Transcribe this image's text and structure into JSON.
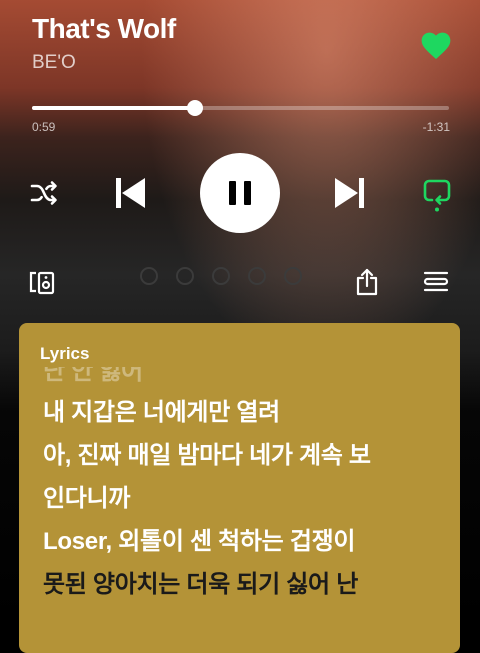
{
  "track": {
    "title": "That's Wolf",
    "artist": "BE'O",
    "liked": true
  },
  "playback": {
    "elapsed": "0:59",
    "remaining": "-1:31",
    "progress": 0.39,
    "state": "playing",
    "shuffle": false,
    "repeat": true
  },
  "colors": {
    "accent": "#1ed760",
    "lyrics_card": "#b49337",
    "background_top": "#a54b33"
  },
  "icons": {
    "like": "heart-icon",
    "shuffle": "shuffle-icon",
    "previous": "skip-previous-icon",
    "pause": "pause-icon",
    "next": "skip-next-icon",
    "repeat": "repeat-icon",
    "devices": "connect-device-icon",
    "share": "share-icon",
    "queue": "queue-icon"
  },
  "lyrics": {
    "heading": "Lyrics",
    "lines": [
      {
        "text": "난 안 잃어",
        "state": "past"
      },
      {
        "text": "내 지갑은 너에게만 열려",
        "state": "upcoming"
      },
      {
        "text": "아, 진짜 매일 밤마다 네가 계속 보",
        "state": "upcoming"
      },
      {
        "text": "인다니까",
        "state": "upcoming"
      },
      {
        "text": "Loser, 외톨이 센 척하는 겁쟁이",
        "state": "upcoming"
      },
      {
        "text": "못된 양아치는 더욱 되기 싫어 난",
        "state": "active"
      }
    ]
  }
}
